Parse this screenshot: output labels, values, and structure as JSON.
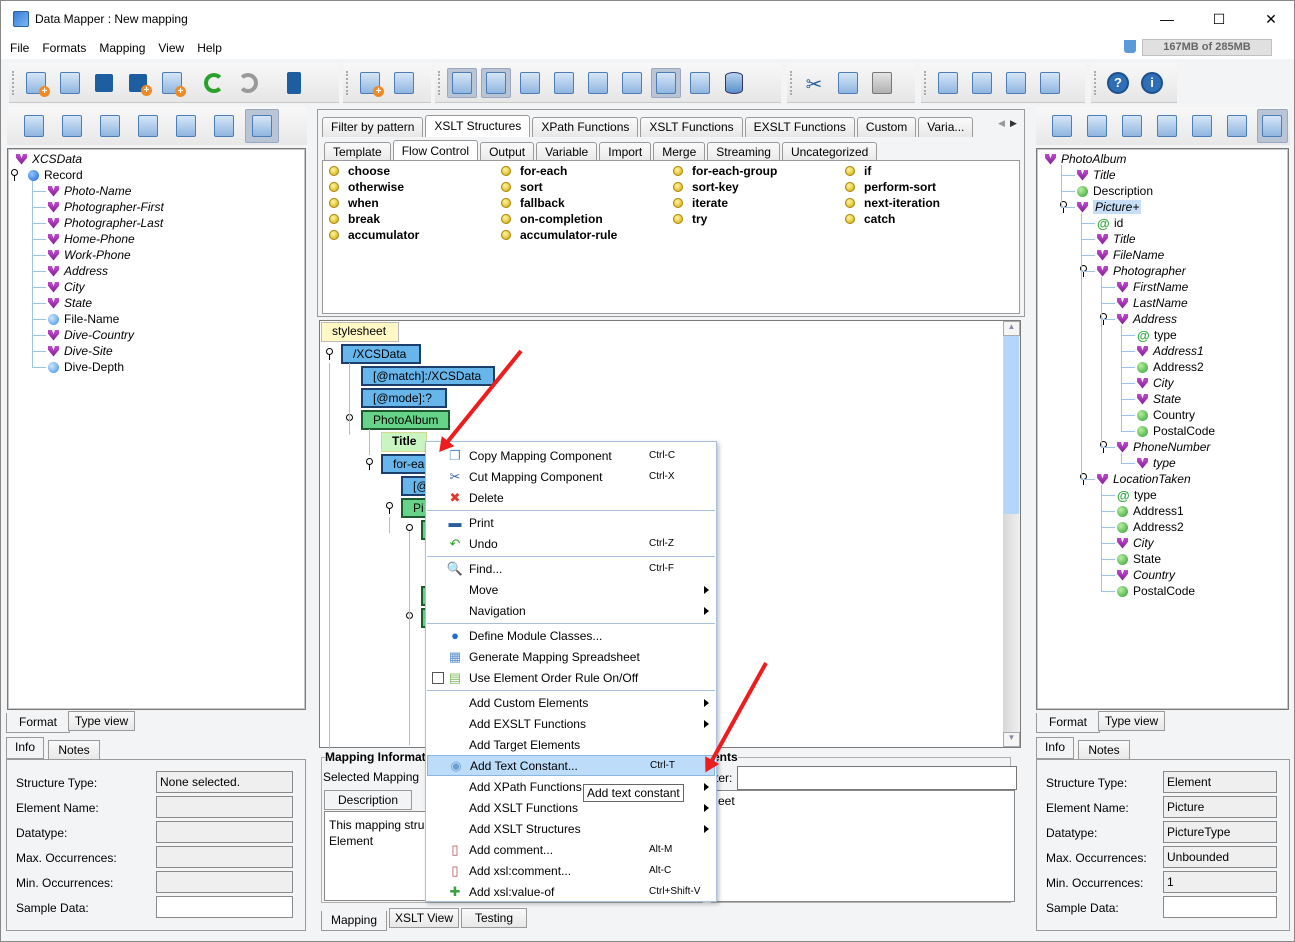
{
  "window": {
    "title": "Data Mapper : New mapping",
    "minimize": "—",
    "maximize": "☐",
    "close": "✕"
  },
  "menubar": [
    "File",
    "Formats",
    "Mapping",
    "View",
    "Help"
  ],
  "memory": "167MB of 285MB",
  "toolbar": {
    "groups": [
      [
        "new-mapping-icon",
        "open-icon",
        "save-icon",
        "save-as-icon",
        "export-xls-icon",
        "undo-icon",
        "redo-icon",
        "exit-icon"
      ],
      [
        "new-mapping-component-icon",
        "mapping-settings-icon"
      ],
      [
        "info-view-icon",
        "color-view-icon",
        "validate-icon",
        "xslt-code-icon",
        "save-history-icon",
        "xml-doc-icon",
        "at-doc-icon",
        "element-order-icon",
        "database-icon"
      ],
      [
        "cut-icon",
        "copy-icon",
        "paste-icon"
      ],
      [
        "move-up-icon",
        "move-left-icon",
        "move-down-icon",
        "order-rule-icon"
      ],
      [
        "help-icon",
        "about-icon"
      ]
    ]
  },
  "left": {
    "tools": [
      "import-source-icon",
      "find-source-icon",
      "source-note-icon",
      "source-map-icon",
      "source-view-icon",
      "source-edit-icon",
      "source-select-icon"
    ],
    "tree": [
      {
        "label": "XCSData",
        "icon": "v",
        "italic": true,
        "level": 0
      },
      {
        "label": "Record",
        "icon": "dotB",
        "italic": false,
        "level": 0,
        "key": true
      },
      {
        "label": "Photo-Name",
        "icon": "v",
        "italic": true,
        "level": 1
      },
      {
        "label": "Photographer-First",
        "icon": "v",
        "italic": true,
        "level": 1
      },
      {
        "label": "Photographer-Last",
        "icon": "v",
        "italic": true,
        "level": 1
      },
      {
        "label": "Home-Phone",
        "icon": "v",
        "italic": true,
        "level": 1
      },
      {
        "label": "Work-Phone",
        "icon": "v",
        "italic": true,
        "level": 1
      },
      {
        "label": "Address",
        "icon": "v",
        "italic": true,
        "level": 1
      },
      {
        "label": "City",
        "icon": "v",
        "italic": true,
        "level": 1
      },
      {
        "label": "State",
        "icon": "v",
        "italic": true,
        "level": 1
      },
      {
        "label": "File-Name",
        "icon": "dotL",
        "italic": false,
        "level": 1
      },
      {
        "label": "Dive-Country",
        "icon": "v",
        "italic": true,
        "level": 1
      },
      {
        "label": "Dive-Site",
        "icon": "v",
        "italic": true,
        "level": 1
      },
      {
        "label": "Dive-Depth",
        "icon": "dotL",
        "italic": false,
        "level": 1
      }
    ],
    "bottom_tabs": [
      "Format",
      "Type view"
    ],
    "info_tabs": [
      "Info",
      "Notes"
    ],
    "fields": [
      {
        "label": "Structure Type:",
        "value": "None selected."
      },
      {
        "label": "Element Name:",
        "value": ""
      },
      {
        "label": "Datatype:",
        "value": ""
      },
      {
        "label": "Max. Occurrences:",
        "value": ""
      },
      {
        "label": "Min. Occurrences:",
        "value": ""
      },
      {
        "label": "Sample Data:",
        "value": ""
      }
    ]
  },
  "right": {
    "tools": [
      "import-target-icon",
      "find-target-icon",
      "target-note-icon",
      "target-map-icon",
      "target-view-icon",
      "target-edit-icon",
      "target-select-icon"
    ],
    "tree": [
      {
        "label": "PhotoAlbum",
        "icon": "v",
        "italic": true,
        "level": 0
      },
      {
        "label": "Title",
        "icon": "v",
        "italic": true,
        "level": 1
      },
      {
        "label": "Description",
        "icon": "dotG",
        "italic": false,
        "level": 1
      },
      {
        "label": "Picture+",
        "icon": "v",
        "italic": true,
        "level": 1,
        "key": true,
        "selected": true
      },
      {
        "label": "id",
        "icon": "at",
        "italic": false,
        "level": 2
      },
      {
        "label": "Title",
        "icon": "v",
        "italic": true,
        "level": 2
      },
      {
        "label": "FileName",
        "icon": "v",
        "italic": true,
        "level": 2
      },
      {
        "label": "Photographer",
        "icon": "v",
        "italic": true,
        "level": 2,
        "key": true
      },
      {
        "label": "FirstName",
        "icon": "v",
        "italic": true,
        "level": 3
      },
      {
        "label": "LastName",
        "icon": "v",
        "italic": true,
        "level": 3
      },
      {
        "label": "Address",
        "icon": "v",
        "italic": true,
        "level": 3,
        "key": true
      },
      {
        "label": "type",
        "icon": "at",
        "italic": false,
        "level": 4
      },
      {
        "label": "Address1",
        "icon": "v",
        "italic": true,
        "level": 4
      },
      {
        "label": "Address2",
        "icon": "dotG",
        "italic": false,
        "level": 4
      },
      {
        "label": "City",
        "icon": "v",
        "italic": true,
        "level": 4
      },
      {
        "label": "State",
        "icon": "v",
        "italic": true,
        "level": 4
      },
      {
        "label": "Country",
        "icon": "dotG",
        "italic": false,
        "level": 4
      },
      {
        "label": "PostalCode",
        "icon": "dotG",
        "italic": false,
        "level": 4
      },
      {
        "label": "PhoneNumber",
        "icon": "v",
        "italic": true,
        "level": 3,
        "key": true
      },
      {
        "label": "type",
        "icon": "vat",
        "italic": true,
        "level": 4
      },
      {
        "label": "LocationTaken",
        "icon": "v",
        "italic": true,
        "level": 2,
        "key": true
      },
      {
        "label": "type",
        "icon": "at",
        "italic": false,
        "level": 3
      },
      {
        "label": "Address1",
        "icon": "dotG",
        "italic": false,
        "level": 3
      },
      {
        "label": "Address2",
        "icon": "dotG",
        "italic": false,
        "level": 3
      },
      {
        "label": "City",
        "icon": "v",
        "italic": true,
        "level": 3
      },
      {
        "label": "State",
        "icon": "dotG",
        "italic": false,
        "level": 3
      },
      {
        "label": "Country",
        "icon": "v",
        "italic": true,
        "level": 3
      },
      {
        "label": "PostalCode",
        "icon": "dotG",
        "italic": false,
        "level": 3
      }
    ],
    "bottom_tabs": [
      "Format",
      "Type view"
    ],
    "info_tabs": [
      "Info",
      "Notes"
    ],
    "fields": [
      {
        "label": "Structure Type:",
        "value": "Element"
      },
      {
        "label": "Element Name:",
        "value": "Picture"
      },
      {
        "label": "Datatype:",
        "value": "PictureType"
      },
      {
        "label": "Max. Occurrences:",
        "value": "Unbounded"
      },
      {
        "label": "Min. Occurrences:",
        "value": "1"
      },
      {
        "label": "Sample Data:",
        "value": ""
      }
    ]
  },
  "palette": {
    "tabs": [
      "Filter by pattern",
      "XSLT Structures",
      "XPath Functions",
      "XSLT Functions",
      "EXSLT Functions",
      "Custom",
      "Varia..."
    ],
    "selected_tab": 1,
    "subtabs": [
      "Template",
      "Flow Control",
      "Output",
      "Variable",
      "Import",
      "Merge",
      "Streaming",
      "Uncategorized"
    ],
    "selected_subtab": 1,
    "columns": [
      [
        "choose",
        "otherwise",
        "when",
        "break",
        "accumulator"
      ],
      [
        "for-each",
        "sort",
        "fallback",
        "on-completion",
        "accumulator-rule"
      ],
      [
        "for-each-group",
        "sort-key",
        "iterate",
        "try"
      ],
      [
        "if",
        "perform-sort",
        "next-iteration",
        "catch"
      ]
    ]
  },
  "mapping_tree": {
    "nodes": [
      {
        "label": "stylesheet",
        "style": "ny"
      },
      {
        "label": "/XCSData",
        "style": "nb"
      },
      {
        "label": "[@match]:/XCSData",
        "style": "nb"
      },
      {
        "label": "[@mode]:?",
        "style": "nb"
      },
      {
        "label": "PhotoAlbum",
        "style": "ng"
      },
      {
        "label": "Title",
        "style": "nlg"
      },
      {
        "label": "for-each",
        "style": "nb"
      },
      {
        "label": "[@",
        "style": "nb"
      },
      {
        "label": "Pi",
        "style": "ng"
      }
    ]
  },
  "context_menu": {
    "items": [
      {
        "label": "Copy Mapping Component",
        "shortcut": "Ctrl-C",
        "icon": "copy-icon"
      },
      {
        "label": "Cut Mapping Component",
        "shortcut": "Ctrl-X",
        "icon": "cut-icon"
      },
      {
        "label": "Delete",
        "shortcut": "",
        "icon": "delete-icon"
      },
      {
        "sep": true
      },
      {
        "label": "Print",
        "shortcut": "",
        "icon": "print-icon"
      },
      {
        "label": "Undo",
        "shortcut": "Ctrl-Z",
        "icon": "undo-icon"
      },
      {
        "sep": true
      },
      {
        "label": "Find...",
        "shortcut": "Ctrl-F",
        "icon": "find-icon"
      },
      {
        "label": "Move",
        "shortcut": "",
        "submenu": true
      },
      {
        "label": "Navigation",
        "shortcut": "",
        "submenu": true
      },
      {
        "sep": true
      },
      {
        "label": "Define Module Classes...",
        "shortcut": "",
        "icon": "info-icon"
      },
      {
        "label": "Generate Mapping Spreadsheet",
        "shortcut": "",
        "icon": "spreadsheet-icon"
      },
      {
        "label": "Use Element Order Rule On/Off",
        "shortcut": "",
        "icon": "order-rule-icon",
        "checkbox": true,
        "checked": false
      },
      {
        "sep": true
      },
      {
        "label": "Add Custom Elements",
        "shortcut": "",
        "submenu": true
      },
      {
        "label": "Add EXSLT Functions",
        "shortcut": "",
        "submenu": true
      },
      {
        "label": "Add Target Elements",
        "shortcut": ""
      },
      {
        "label": "Add Text Constant...",
        "shortcut": "Ctrl-T",
        "icon": "text-constant-icon",
        "highlighted": true
      },
      {
        "label": "Add XPath Functions",
        "shortcut": "",
        "submenu": true
      },
      {
        "label": "Add XSLT Functions",
        "shortcut": "",
        "submenu": true
      },
      {
        "label": "Add XSLT Structures",
        "shortcut": "",
        "submenu": true
      },
      {
        "label": "Add comment...",
        "shortcut": "Alt-M",
        "icon": "comment-icon"
      },
      {
        "label": "Add xsl:comment...",
        "shortcut": "Alt-C",
        "icon": "comment-icon"
      },
      {
        "label": "Add xsl:value-of",
        "shortcut": "Ctrl+Shift-V",
        "icon": "value-of-icon"
      }
    ],
    "tooltip": "Add text constant"
  },
  "mapping_info": {
    "title": "Mapping Informat",
    "selected_label": "Selected Mapping",
    "desc_tab": "Description",
    "desc_text_line1": "This mapping stru",
    "desc_text_line2": "Element",
    "comments_title": "ents",
    "filter_label": "ter:",
    "comments_text": "eet"
  },
  "bottom_tabs": [
    "Mapping",
    "XSLT View",
    "Testing"
  ],
  "bottom_selected": 0
}
